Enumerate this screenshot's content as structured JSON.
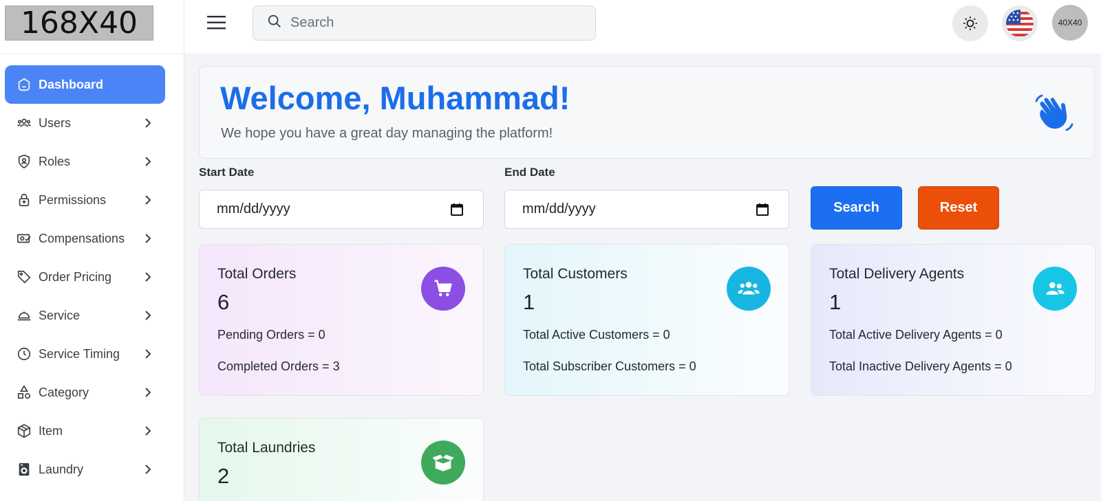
{
  "logo": {
    "text": "168X40"
  },
  "sidebar": {
    "items": [
      {
        "label": "Dashboard",
        "icon": "dashboard-icon",
        "active": true
      },
      {
        "label": "Users",
        "icon": "users-icon"
      },
      {
        "label": "Roles",
        "icon": "shield-user-icon"
      },
      {
        "label": "Permissions",
        "icon": "lock-icon"
      },
      {
        "label": "Compensations",
        "icon": "money-check-icon"
      },
      {
        "label": "Order Pricing",
        "icon": "tag-icon"
      },
      {
        "label": "Service",
        "icon": "service-icon"
      },
      {
        "label": "Service Timing",
        "icon": "clock-icon"
      },
      {
        "label": "Category",
        "icon": "shapes-icon"
      },
      {
        "label": "Item",
        "icon": "box-icon"
      },
      {
        "label": "Laundry",
        "icon": "washing-machine-icon"
      }
    ]
  },
  "topbar": {
    "search_placeholder": "Search",
    "avatar_text": "40X40"
  },
  "welcome": {
    "title": "Welcome, Muhammad!",
    "subtitle": "We hope you have a great day managing the platform!"
  },
  "filters": {
    "start_label": "Start Date",
    "start_value": "mm/dd/yyyy",
    "end_label": "End Date",
    "end_value": "mm/dd/yyyy",
    "search_label": "Search",
    "reset_label": "Reset"
  },
  "cards": {
    "orders": {
      "title": "Total Orders",
      "value": "6",
      "line1": "Pending Orders  = 0",
      "line2": "Completed Orders  = 3",
      "icon": "cart-icon",
      "color": "#8b4fe3"
    },
    "customers": {
      "title": "Total Customers",
      "value": "1",
      "line1": "Total Active Customers  = 0",
      "line2": "Total Subscriber Customers  = 0",
      "icon": "users-icon",
      "color": "#17b6e2"
    },
    "agents": {
      "title": "Total Delivery Agents",
      "value": "1",
      "line1": "Total Active Delivery Agents  = 0",
      "line2": "Total Inactive Delivery Agents  = 0",
      "icon": "user-group-icon",
      "color": "#17c6e6"
    },
    "laundries": {
      "title": "Total Laundries",
      "value": "2",
      "icon": "open-box-icon",
      "color": "#3faa5b"
    }
  },
  "colors": {
    "accent": "#1c6ee8",
    "sidebar_active": "#4b84f6",
    "search_button": "#1b6ff0",
    "reset_button": "#ec4f09"
  }
}
